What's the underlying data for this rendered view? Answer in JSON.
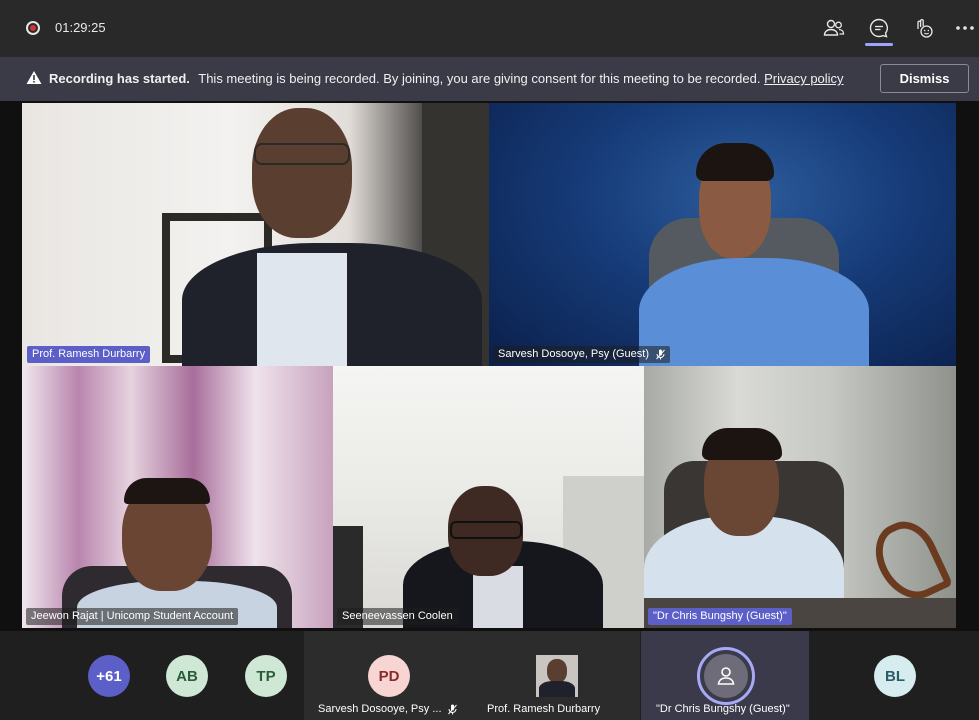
{
  "topbar": {
    "timer": "01:29:25",
    "icons": [
      "recording-indicator",
      "people-icon",
      "chat-icon",
      "reactions-icon",
      "more-icon"
    ]
  },
  "banner": {
    "title": "Recording has started.",
    "message": "This meeting is being recorded. By joining, you are giving consent for this meeting to be recorded.",
    "link": "Privacy policy",
    "dismiss_label": "Dismiss"
  },
  "tiles": [
    {
      "name": "Prof. Ramesh Durbarry",
      "highlight": true
    },
    {
      "name": "Sarvesh Dosooye, Psy (Guest)",
      "muted": true
    },
    {
      "name": "Jeewon Rajat | Unicomp Student Account"
    },
    {
      "name": "Seeneevassen Coolen"
    },
    {
      "name": "\"Dr Chris Bungshy (Guest)\"",
      "highlight": true
    }
  ],
  "roster": {
    "more_count": "+61",
    "avatars": [
      {
        "initials": "AB"
      },
      {
        "initials": "TP"
      }
    ],
    "people": [
      {
        "initials": "PD",
        "name": "Sarvesh Dosooye, Psy ...",
        "muted": true
      },
      {
        "name": "Prof. Ramesh Durbarry"
      },
      {
        "name": "\"Dr Chris Bungshy (Guest)\"",
        "speaking": true
      },
      {
        "initials": "BL"
      }
    ]
  },
  "colors": {
    "accent": "#5b5fc7",
    "banner": "#3b3a47",
    "record": "#d13438"
  }
}
